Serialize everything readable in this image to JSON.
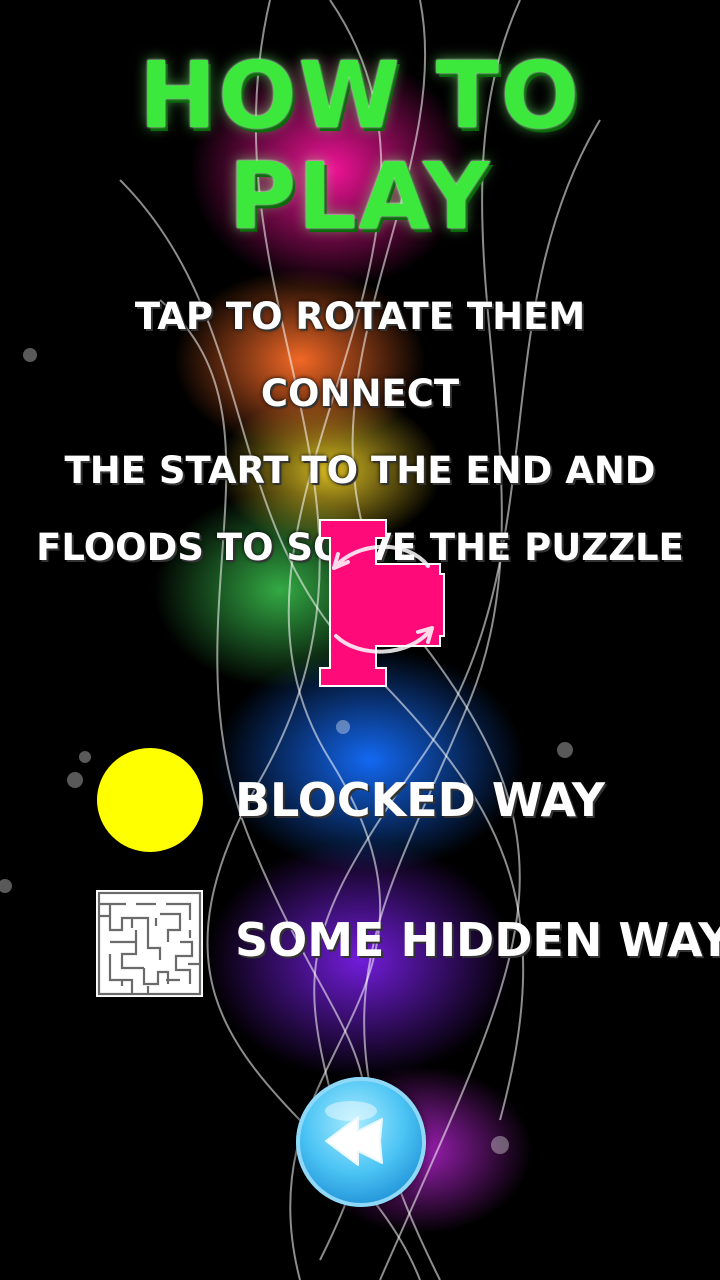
{
  "screen": {
    "title": "HOW TO PLAY",
    "instructions": [
      "TAP TO ROTATE THEM CONNECT",
      "THE START TO THE END AND",
      "FLOODS TO SOLVE THE PUZZLE"
    ]
  },
  "example_pipe": {
    "icon": "rotate-pipe-icon",
    "color": "#ff0a78"
  },
  "legend": [
    {
      "icon": "yellow-circle-icon",
      "label": "BLOCKED WAY",
      "color": "#ffff00"
    },
    {
      "icon": "maze-icon",
      "label": "SOME HIDDEN WAY"
    }
  ],
  "back_button": {
    "icon": "back-arrow-icon"
  },
  "colors": {
    "title": "#3de83d",
    "text": "#ffffff",
    "button": "#4cc4f4"
  }
}
